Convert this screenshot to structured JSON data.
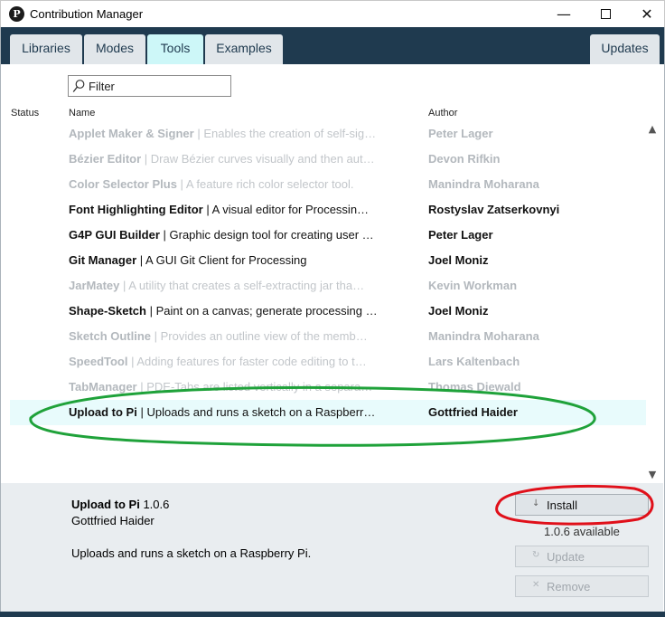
{
  "window": {
    "title": "Contribution Manager",
    "minimize_glyph": "—",
    "close_glyph": "✕"
  },
  "tabs": [
    {
      "label": "Libraries",
      "active": false
    },
    {
      "label": "Modes",
      "active": false
    },
    {
      "label": "Tools",
      "active": true
    },
    {
      "label": "Examples",
      "active": false
    }
  ],
  "updates_tab": {
    "label": "Updates"
  },
  "filter": {
    "placeholder": "Filter",
    "value": ""
  },
  "columns": {
    "status": "Status",
    "name": "Name",
    "author": "Author"
  },
  "rows": [
    {
      "title": "Applet Maker & Signer",
      "sep": " | ",
      "desc": "Enables the creation of self-sig…",
      "author": "Peter Lager",
      "installed": false
    },
    {
      "title": "Bézier Editor",
      "sep": " | ",
      "desc": "Draw Bézier curves visually and then aut…",
      "author": "Devon Rifkin",
      "installed": false
    },
    {
      "title": "Color Selector Plus",
      "sep": " | ",
      "desc": "A feature rich color selector tool.",
      "author": "Manindra Moharana",
      "installed": false
    },
    {
      "title": "Font Highlighting Editor",
      "sep": " | ",
      "desc": "A visual editor for Processin…",
      "author": "Rostyslav Zatserkovnyi",
      "installed": true
    },
    {
      "title": "G4P GUI Builder",
      "sep": " | ",
      "desc": "Graphic design tool for creating user …",
      "author": "Peter Lager",
      "installed": true
    },
    {
      "title": "Git Manager",
      "sep": " | ",
      "desc": "A GUI Git Client for Processing",
      "author": "Joel Moniz",
      "installed": true
    },
    {
      "title": "JarMatey",
      "sep": " | ",
      "desc": "A utility that creates a self-extracting jar tha…",
      "author": "Kevin Workman",
      "installed": false
    },
    {
      "title": "Shape-Sketch",
      "sep": " | ",
      "desc": "Paint on a canvas; generate processing …",
      "author": "Joel Moniz",
      "installed": true
    },
    {
      "title": "Sketch Outline",
      "sep": " | ",
      "desc": "Provides an outline view of the memb…",
      "author": "Manindra Moharana",
      "installed": false
    },
    {
      "title": "SpeedTool",
      "sep": " | ",
      "desc": "Adding features for faster code editing to t…",
      "author": "Lars Kaltenbach",
      "installed": false
    },
    {
      "title": "TabManager",
      "sep": " | ",
      "desc": "PDE-Tabs are listed vertically in a separa…",
      "author": "Thomas Diewald",
      "installed": false
    },
    {
      "title": "Upload to Pi",
      "sep": " | ",
      "desc": "Uploads and runs a sketch on a Raspberr…",
      "author": "Gottfried Haider",
      "installed": true,
      "selected": true
    }
  ],
  "details": {
    "title": "Upload to Pi",
    "version": " 1.0.6",
    "author": "Gottfried Haider",
    "description": "Uploads and runs a sketch on a Raspberry Pi.",
    "available": "1.0.6 available"
  },
  "buttons": {
    "install": {
      "label": "Install",
      "icon": "download-arrow-icon"
    },
    "update": {
      "label": "Update",
      "icon": "refresh-icon"
    },
    "remove": {
      "label": "Remove",
      "icon": "remove-x-icon"
    }
  },
  "colors": {
    "header_bg": "#1f3a4f",
    "active_tab": "#cdf7f8",
    "selected_row": "#e8fbfc",
    "annotation_green": "#1fa23a",
    "annotation_red": "#e0101a"
  }
}
